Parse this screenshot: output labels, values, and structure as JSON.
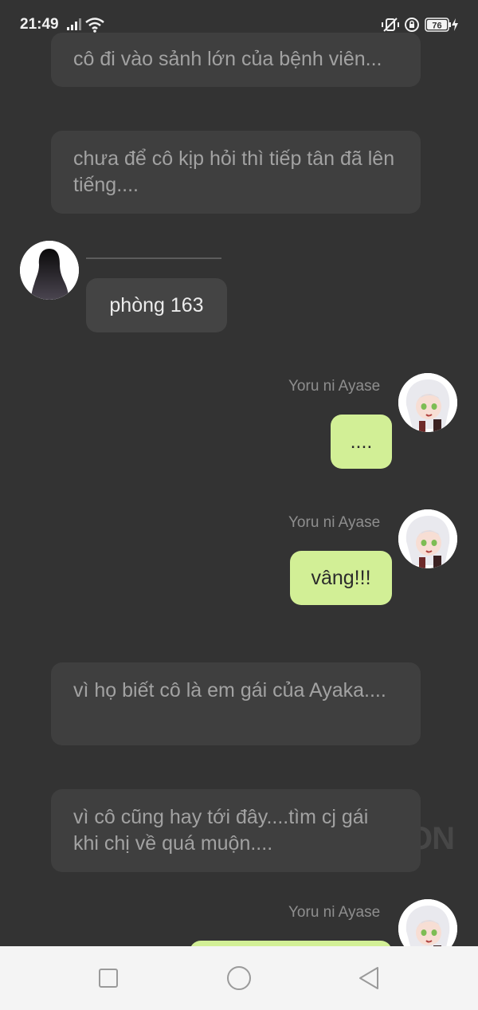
{
  "status_bar": {
    "time": "21:49",
    "battery": "76"
  },
  "messages": {
    "narration_1": "cô đi vào sảnh lớn của bệnh viên...",
    "narration_2": "chưa để cô kịp hỏi thì tiếp tân đã lên tiếng....",
    "left_message": "phòng 163",
    "sender_name": "Yoru ni Ayase",
    "reply_1": "....",
    "reply_2": "vâng!!!",
    "narration_3": "vì họ biết cô là em gái của Ayaka....",
    "narration_4": "vì cô cũng hay tới đây....tìm cj gái khi chị về quá muộn...."
  },
  "watermark": "ON",
  "colors": {
    "background": "#333333",
    "narration_bubble": "#3f3f3f",
    "reply_bubble": "#d2ef96",
    "nav_bar": "#f4f4f4"
  },
  "nav": {
    "icons": [
      "recent-apps-icon",
      "home-icon",
      "back-icon"
    ]
  }
}
